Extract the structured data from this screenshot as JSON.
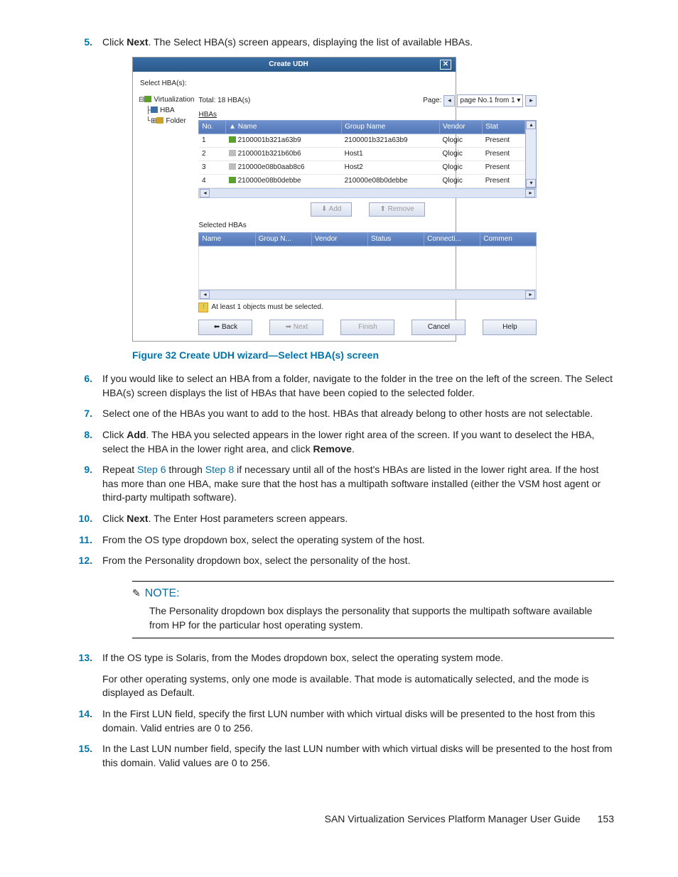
{
  "steps": {
    "s5": {
      "num": "5.",
      "pre": "Click ",
      "bold": "Next",
      "post": ". The Select HBA(s) screen appears, displaying the list of available HBAs."
    },
    "s6": {
      "num": "6.",
      "text": "If you would like to select an HBA from a folder, navigate to the folder in the tree on the left of the screen. The Select HBA(s) screen displays the list of HBAs that have been copied to the selected folder."
    },
    "s7": {
      "num": "7.",
      "text": "Select one of the HBAs you want to add to the host. HBAs that already belong to other hosts are not selectable."
    },
    "s8": {
      "num": "8.",
      "pre": "Click ",
      "bold": "Add",
      "mid": ". The HBA you selected appears in the lower right area of the screen. If you want to deselect the HBA, select the HBA in the lower right area, and click ",
      "bold2": "Remove",
      "post": "."
    },
    "s9": {
      "num": "9.",
      "pre": "Repeat ",
      "link1": "Step 6",
      "mid": " through ",
      "link2": "Step 8",
      "post": " if necessary until all of the host's HBAs are listed in the lower right area. If the host has more than one HBA, make sure that the host has a multipath software installed (either the VSM host agent or third-party multipath software)."
    },
    "s10": {
      "num": "10.",
      "pre": "Click ",
      "bold": "Next",
      "post": ". The Enter Host parameters screen appears."
    },
    "s11": {
      "num": "11.",
      "text": "From the OS type dropdown box, select the operating system of the host."
    },
    "s12": {
      "num": "12.",
      "text": "From the Personality dropdown box, select the personality of the host."
    },
    "s13": {
      "num": "13.",
      "text": "If the OS type is Solaris, from the Modes dropdown box, select the operating system mode.",
      "p2": "For other operating systems, only one mode is available. That mode is automatically selected, and the mode is displayed as Default."
    },
    "s14": {
      "num": "14.",
      "text": "In the First LUN field, specify the first LUN number with which virtual disks will be presented to the host from this domain. Valid entries are 0 to 256."
    },
    "s15": {
      "num": "15.",
      "text": "In the Last LUN number field, specify the last LUN number with which virtual disks will be presented to the host from this domain. Valid values are 0 to 256."
    }
  },
  "figure_caption": "Figure 32 Create UDH wizard—Select HBA(s) screen",
  "note": {
    "title": "NOTE:",
    "text": "The Personality dropdown box displays the personality that supports the multipath software available from HP for the particular host operating system."
  },
  "footer": {
    "title": "SAN Virtualization Services Platform Manager User Guide",
    "page": "153"
  },
  "dialog": {
    "title": "Create UDH",
    "select_label": "Select HBA(s):",
    "tree": {
      "root": "Virtualization",
      "hba": "HBA",
      "folder": "Folder"
    },
    "total": "Total: 18 HBA(s)",
    "page_label": "Page:",
    "page_sel": "page No.1 from 1",
    "hbas_label": "HBAs",
    "cols": {
      "no": "No.",
      "name": "Name",
      "group": "Group Name",
      "vendor": "Vendor",
      "stat": "Stat"
    },
    "rows": [
      {
        "no": "1",
        "name": "2100001b321a63b9",
        "group": "2100001b321a63b9",
        "vendor": "Qlogic",
        "stat": "Present",
        "g": true
      },
      {
        "no": "2",
        "name": "2100001b321b60b6",
        "group": "Host1",
        "vendor": "Qlogic",
        "stat": "Present",
        "g": false
      },
      {
        "no": "3",
        "name": "210000e08b0aab8c6",
        "group": "Host2",
        "vendor": "Qlogic",
        "stat": "Present",
        "g": false
      },
      {
        "no": "4",
        "name": "210000e08b0debbe",
        "group": "210000e08b0debbe",
        "vendor": "Qlogic",
        "stat": "Present",
        "g": true
      }
    ],
    "add_label": "Add",
    "remove_label": "Remove",
    "selected_label": "Selected HBAs",
    "selcols": {
      "name": "Name",
      "group": "Group N...",
      "vendor": "Vendor",
      "status": "Status",
      "conn": "Connecti...",
      "comm": "Commen"
    },
    "warn": "At least 1 objects must be selected.",
    "btns": {
      "back": "Back",
      "next": "Next",
      "finish": "Finish",
      "cancel": "Cancel",
      "help": "Help"
    }
  }
}
